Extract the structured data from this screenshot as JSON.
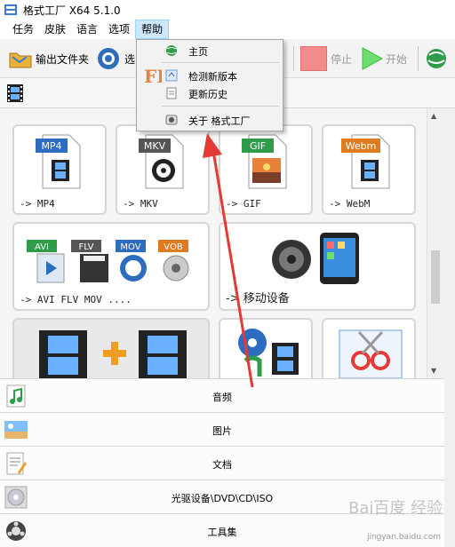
{
  "window": {
    "title": "格式工厂 X64 5.1.0"
  },
  "menubar": {
    "items": [
      "任务",
      "皮肤",
      "语言",
      "选项",
      "帮助"
    ]
  },
  "toolbar": {
    "output_folder": "输出文件夹",
    "options_partial": "选",
    "stop": "停止",
    "start": "开始"
  },
  "help_menu": {
    "items": [
      {
        "label": "主页",
        "icon": "globe-icon"
      },
      {
        "label": "检测新版本",
        "icon": "update-icon"
      },
      {
        "label": "更新历史",
        "icon": "document-icon"
      },
      {
        "label": "关于 格式工厂",
        "icon": "info-icon"
      }
    ],
    "logo_text": "FF"
  },
  "tiles": [
    {
      "badge": "MP4",
      "label": "-> MP4",
      "badge_color": "#2d6cc0"
    },
    {
      "badge": "MKV",
      "label": "-> MKV",
      "badge_color": "#555555"
    },
    {
      "badge": "GIF",
      "label": "-> GIF",
      "badge_color": "#2f9c4a"
    },
    {
      "badge": "Webm",
      "label": "-> WebM",
      "badge_color": "#e07b1f"
    },
    {
      "badges": [
        "AVI",
        "FLV",
        "MOV",
        "VOB"
      ],
      "label": "-> AVI FLV MOV ...."
    },
    {
      "label": "-> 移动设备"
    }
  ],
  "categories": [
    {
      "label": "音频",
      "icon": "music-icon"
    },
    {
      "label": "图片",
      "icon": "picture-icon"
    },
    {
      "label": "文档",
      "icon": "document-icon"
    },
    {
      "label": "光驱设备\\DVD\\CD\\ISO",
      "icon": "disc-icon"
    },
    {
      "label": "工具集",
      "icon": "tools-icon"
    }
  ],
  "watermark": {
    "text": "Bai百度 经验",
    "url_text": "jingyan.baidu.com"
  },
  "colors": {
    "menu_highlight": "#cce8ff",
    "annotation_arrow": "#e53935",
    "stop_red": "#f28b8b",
    "start_green": "#3cc43c"
  }
}
